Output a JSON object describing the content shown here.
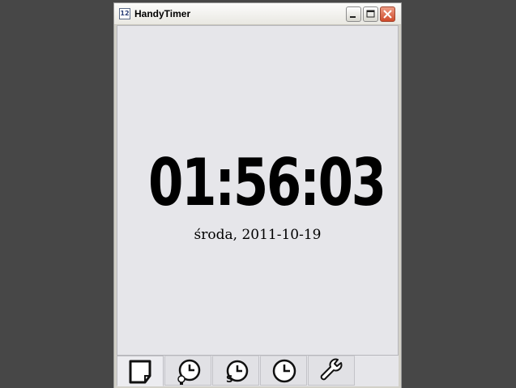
{
  "window": {
    "title": "HandyTimer",
    "icon": "calendar-12-icon",
    "icon_text": "12",
    "controls": [
      "minimize-icon",
      "maximize-icon",
      "close-icon"
    ]
  },
  "clock": {
    "time": "01:56:03",
    "date": "środa, 2011-10-19"
  },
  "tabs": [
    {
      "name": "clock-page",
      "icon": "page-icon",
      "active": true
    },
    {
      "name": "alarm",
      "icon": "alarm-clock-icon",
      "active": false
    },
    {
      "name": "stopwatch",
      "icon": "stopwatch-icon",
      "active": false
    },
    {
      "name": "timer",
      "icon": "clock-icon",
      "active": false
    },
    {
      "name": "settings",
      "icon": "wrench-icon",
      "active": false
    }
  ],
  "colors": {
    "background": "#474747",
    "client": "#e6e6ea",
    "close_button": "#cf4a2a"
  }
}
